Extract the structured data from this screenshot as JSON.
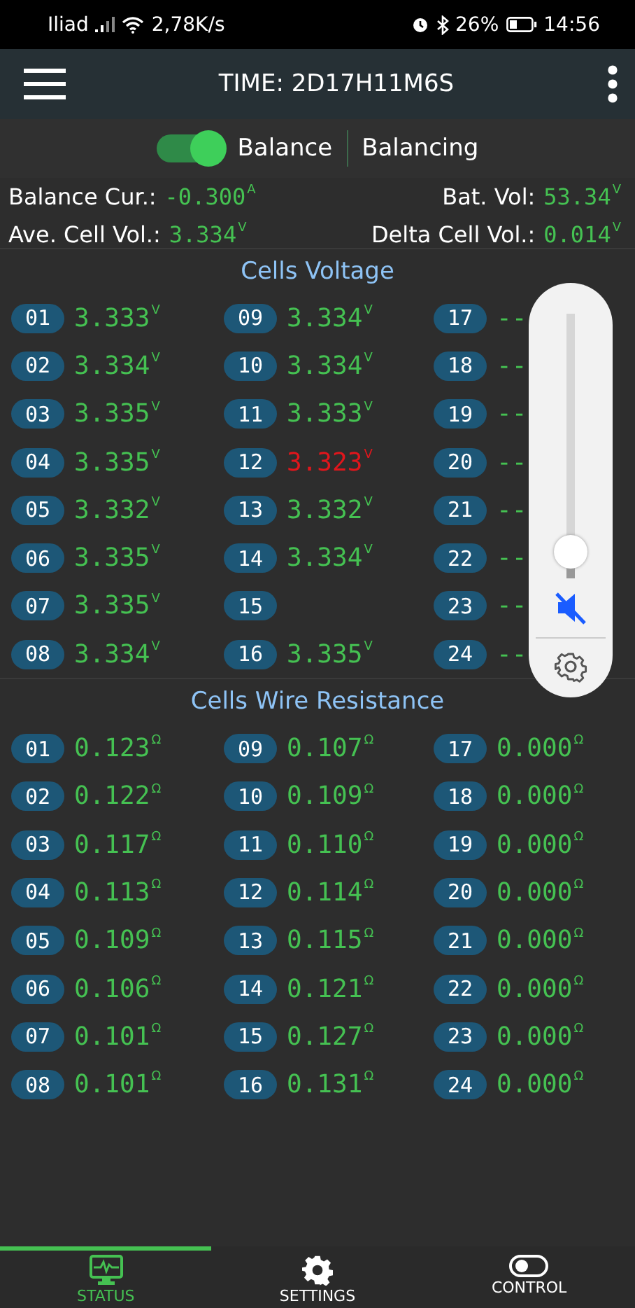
{
  "status_bar": {
    "carrier": "Iliad",
    "speed": "2,78K/s",
    "battery": "26%",
    "time": "14:56"
  },
  "header": {
    "title": "TIME: 2D17H11M6S"
  },
  "balance": {
    "label": "Balance",
    "on": true,
    "status": "Balancing"
  },
  "stats": [
    {
      "label": "Balance Cur.:",
      "value": "-0.300",
      "unit": "A"
    },
    {
      "label": "Bat. Vol:",
      "value": "53.34",
      "unit": "V"
    },
    {
      "label": "Ave. Cell Vol.:",
      "value": "3.334",
      "unit": "V"
    },
    {
      "label": "Delta Cell Vol.:",
      "value": "0.014",
      "unit": "V"
    }
  ],
  "sections": [
    {
      "title": "Cells Voltage",
      "cells": [
        {
          "num": "01",
          "value": "3.333",
          "unit": "V",
          "color": "#45c152"
        },
        {
          "num": "02",
          "value": "3.334",
          "unit": "V",
          "color": "#45c152"
        },
        {
          "num": "03",
          "value": "3.335",
          "unit": "V",
          "color": "#45c152"
        },
        {
          "num": "04",
          "value": "3.335",
          "unit": "V",
          "color": "#45c152"
        },
        {
          "num": "05",
          "value": "3.332",
          "unit": "V",
          "color": "#45c152"
        },
        {
          "num": "06",
          "value": "3.335",
          "unit": "V",
          "color": "#45c152"
        },
        {
          "num": "07",
          "value": "3.335",
          "unit": "V",
          "color": "#45c152"
        },
        {
          "num": "08",
          "value": "3.334",
          "unit": "V",
          "color": "#45c152"
        },
        {
          "num": "09",
          "value": "3.334",
          "unit": "V",
          "color": "#45c152"
        },
        {
          "num": "10",
          "value": "3.334",
          "unit": "V",
          "color": "#45c152"
        },
        {
          "num": "11",
          "value": "3.333",
          "unit": "V",
          "color": "#45c152"
        },
        {
          "num": "12",
          "value": "3.323",
          "unit": "V",
          "color": "#e0161c"
        },
        {
          "num": "13",
          "value": "3.332",
          "unit": "V",
          "color": "#45c152"
        },
        {
          "num": "14",
          "value": "3.334",
          "unit": "V",
          "color": "#45c152"
        },
        {
          "num": "15"
        },
        {
          "num": "16",
          "value": "3.335",
          "unit": "V",
          "color": "#45c152"
        },
        {
          "num": "17",
          "value": "--",
          "color": "#45c152"
        },
        {
          "num": "18",
          "value": "--",
          "color": "#45c152"
        },
        {
          "num": "19",
          "value": "--",
          "color": "#45c152"
        },
        {
          "num": "20",
          "value": "--",
          "color": "#45c152"
        },
        {
          "num": "21",
          "value": "--",
          "color": "#45c152"
        },
        {
          "num": "22",
          "value": "--",
          "color": "#45c152"
        },
        {
          "num": "23",
          "value": "--",
          "color": "#45c152"
        },
        {
          "num": "24",
          "value": "--",
          "color": "#45c152"
        }
      ]
    },
    {
      "title": "Cells Wire Resistance",
      "cells": [
        {
          "num": "01",
          "value": "0.123",
          "unit": "Ω",
          "color": "#45c152"
        },
        {
          "num": "02",
          "value": "0.122",
          "unit": "Ω",
          "color": "#45c152"
        },
        {
          "num": "03",
          "value": "0.117",
          "unit": "Ω",
          "color": "#45c152"
        },
        {
          "num": "04",
          "value": "0.113",
          "unit": "Ω",
          "color": "#45c152"
        },
        {
          "num": "05",
          "value": "0.109",
          "unit": "Ω",
          "color": "#45c152"
        },
        {
          "num": "06",
          "value": "0.106",
          "unit": "Ω",
          "color": "#45c152"
        },
        {
          "num": "07",
          "value": "0.101",
          "unit": "Ω",
          "color": "#45c152"
        },
        {
          "num": "08",
          "value": "0.101",
          "unit": "Ω",
          "color": "#45c152"
        },
        {
          "num": "09",
          "value": "0.107",
          "unit": "Ω",
          "color": "#45c152"
        },
        {
          "num": "10",
          "value": "0.109",
          "unit": "Ω",
          "color": "#45c152"
        },
        {
          "num": "11",
          "value": "0.110",
          "unit": "Ω",
          "color": "#45c152"
        },
        {
          "num": "12",
          "value": "0.114",
          "unit": "Ω",
          "color": "#45c152"
        },
        {
          "num": "13",
          "value": "0.115",
          "unit": "Ω",
          "color": "#45c152"
        },
        {
          "num": "14",
          "value": "0.121",
          "unit": "Ω",
          "color": "#45c152"
        },
        {
          "num": "15",
          "value": "0.127",
          "unit": "Ω",
          "color": "#45c152"
        },
        {
          "num": "16",
          "value": "0.131",
          "unit": "Ω",
          "color": "#45c152"
        },
        {
          "num": "17",
          "value": "0.000",
          "unit": "Ω",
          "color": "#45c152"
        },
        {
          "num": "18",
          "value": "0.000",
          "unit": "Ω",
          "color": "#45c152"
        },
        {
          "num": "19",
          "value": "0.000",
          "unit": "Ω",
          "color": "#45c152"
        },
        {
          "num": "20",
          "value": "0.000",
          "unit": "Ω",
          "color": "#45c152"
        },
        {
          "num": "21",
          "value": "0.000",
          "unit": "Ω",
          "color": "#45c152"
        },
        {
          "num": "22",
          "value": "0.000",
          "unit": "Ω",
          "color": "#45c152"
        },
        {
          "num": "23",
          "value": "0.000",
          "unit": "Ω",
          "color": "#45c152"
        },
        {
          "num": "24",
          "value": "0.000",
          "unit": "Ω",
          "color": "#45c152"
        }
      ]
    }
  ],
  "volume_panel": {
    "level": 0.1,
    "muted": true
  },
  "tabs": [
    {
      "label": "STATUS",
      "selected": true
    },
    {
      "label": "SETTINGS",
      "selected": false
    },
    {
      "label": "CONTROL",
      "selected": false
    }
  ]
}
